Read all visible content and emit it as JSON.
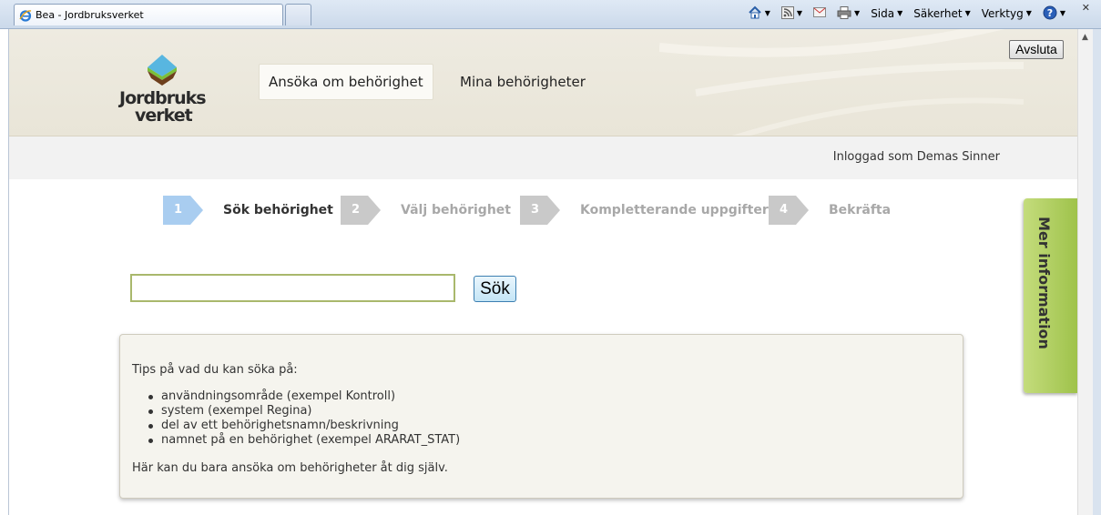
{
  "browser": {
    "tab_title": "Bea - Jordbruksverket",
    "commands": {
      "page": "Sida",
      "security": "Säkerhet",
      "tools": "Verktyg"
    }
  },
  "header": {
    "logo_line1": "Jordbruks",
    "logo_line2": "verket",
    "nav": {
      "apply": "Ansöka om behörighet",
      "mine": "Mina behörigheter"
    }
  },
  "userbar": {
    "logged_in_text": "Inloggad som Demas Sinner",
    "logout_label": "Avsluta"
  },
  "steps": [
    {
      "num": "1",
      "label": "Sök behörighet",
      "state": "active"
    },
    {
      "num": "2",
      "label": "Välj behörighet",
      "state": "inactive"
    },
    {
      "num": "3",
      "label": "Kompletterande uppgifter",
      "state": "inactive"
    },
    {
      "num": "4",
      "label": "Bekräfta",
      "state": "inactive"
    }
  ],
  "search": {
    "value": "",
    "button_label": "Sök"
  },
  "tips": {
    "heading": "Tips på vad du kan söka på:",
    "items": [
      "användningsområde (exempel Kontroll)",
      "system (exempel Regina)",
      "del av ett behörighetsnamn/beskrivning",
      "namnet på en behörighet (exempel ARARAT_STAT)"
    ],
    "footer": "Här kan du bara ansöka om behörigheter åt dig själv."
  },
  "side_tab": {
    "label": "Mer information"
  },
  "colors": {
    "step_active": "#a9cdf0",
    "step_inactive": "#c9c9c9",
    "side_tab_green": "#b0cf5e",
    "input_border": "#a9b86c"
  }
}
